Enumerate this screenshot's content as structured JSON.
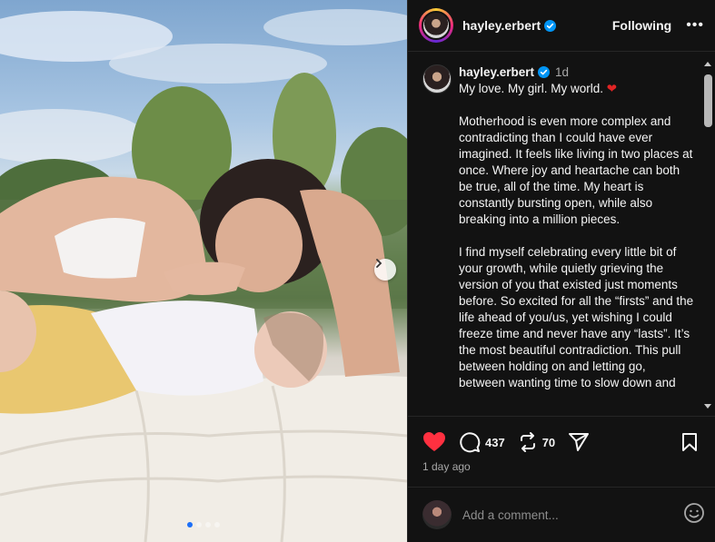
{
  "header": {
    "username": "hayley.erbert",
    "follow_label": "Following",
    "more_label": "•••"
  },
  "caption": {
    "username": "hayley.erbert",
    "time": "1d",
    "first_line": "My love. My girl. My world. ",
    "heart": "❤",
    "body": "\nMotherhood is even more complex and contradicting than I could have ever imagined. It feels like living in two places at once. Where joy and heartache can both be true, all of the time. My heart is constantly bursting open, while also breaking into a million pieces.\n\nI find myself celebrating every little bit of your growth, while quietly grieving the version of you that existed just moments before. So excited for all the “firsts” and the life ahead of you/us, yet wishing I could freeze time and never have any “lasts”. It’s the most beautiful contradiction. This pull between holding on and letting go, between wanting time to slow down and"
  },
  "actions": {
    "comments": "437",
    "reposts": "70",
    "like_color": "#ff3040"
  },
  "posted": "1 day ago",
  "comment": {
    "placeholder": "Add a comment..."
  },
  "carousel": {
    "total": 4,
    "active": 1
  },
  "colors": {
    "verified": "#0095f6",
    "dot_active": "#1c6ff8"
  }
}
